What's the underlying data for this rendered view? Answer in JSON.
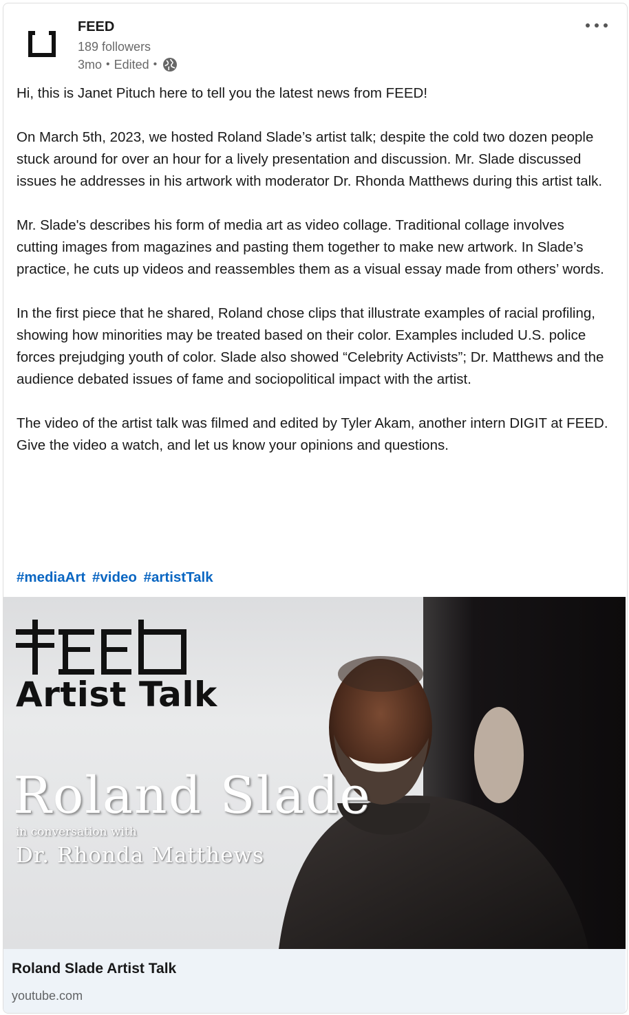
{
  "header": {
    "page_name": "FEED",
    "followers": "189 followers",
    "time": "3mo",
    "edited": "Edited",
    "separator": "•",
    "visibility_icon": "globe-icon",
    "menu_icon": "more-horizontal-icon"
  },
  "post": {
    "paragraphs": [
      "Hi, this is Janet Pituch here to tell you the latest news from FEED!",
      "On March 5th, 2023, we hosted Roland Slade’s artist talk;  despite the cold two dozen people stuck around for over an hour for a lively presentation and discussion. Mr. Slade discussed issues he addresses in his artwork with moderator Dr. Rhonda Matthews during this artist talk.",
      "Mr. Slade's describes his form of media art as video collage. Traditional collage involves cutting images from magazines and pasting them together to make new artwork. In Slade’s practice, he cuts up videos and reassembles them as a visual essay made from others’ words.",
      "In the first piece that he shared, Roland chose clips that illustrate examples of racial profiling, showing how minorities may be treated based on their color. Examples included U.S. police forces prejudging youth of color. Slade also showed “Celebrity Activists”; Dr. Matthews and the audience debated issues of fame and sociopolitical impact with the artist.",
      "The video of the artist talk was filmed and edited by Tyler Akam, another intern DIGIT at FEED. Give the video a watch, and let us know your opinions and questions."
    ],
    "hashtags": [
      "#mediaArt",
      "#video",
      "#artistTalk"
    ]
  },
  "thumbnail": {
    "heading": "Artist Talk",
    "name": "Roland Slade",
    "subtitle": "in conversation with",
    "guest": "Dr. Rhonda Matthews"
  },
  "link": {
    "title": "Roland Slade Artist Talk",
    "domain": "youtube.com"
  },
  "colors": {
    "hashtag": "#0a66c2",
    "footer_bg": "#eef3f8"
  }
}
